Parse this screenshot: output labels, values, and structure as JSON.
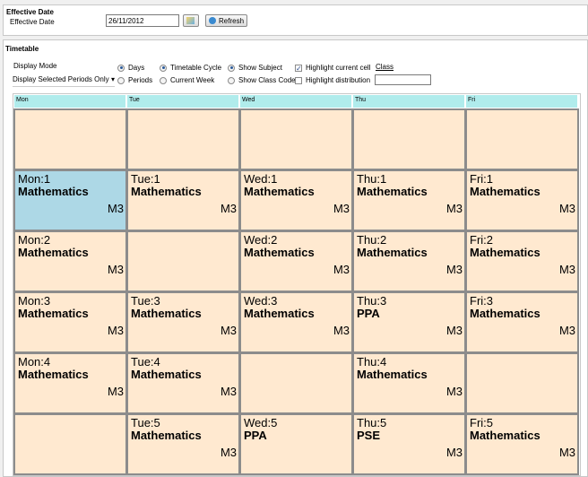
{
  "effective_date": {
    "section_title": "Effective Date",
    "label": "Effective Date",
    "value": "26/11/2012",
    "refresh_label": "Refresh"
  },
  "timetable": {
    "section_title": "Timetable",
    "display_mode_label": "Display Mode",
    "display_select": "Display Selected Periods Only",
    "radios": {
      "days": "Days",
      "periods": "Periods",
      "timetable_cycle": "Timetable Cycle",
      "current_week": "Current Week",
      "show_subject": "Show Subject",
      "show_class_code": "Show Class Code"
    },
    "selected": {
      "view": "Days",
      "cycle": "Timetable Cycle",
      "show": "Show Subject"
    },
    "checks": {
      "highlight_current": "Highlight current cell",
      "highlight_current_checked": true,
      "highlight_distribution": "Highlight distribution",
      "highlight_distribution_checked": false
    },
    "class_link": "Class",
    "class_value": "",
    "days": [
      "Mon",
      "Tue",
      "Wed",
      "Thu",
      "Fri"
    ],
    "rows": [
      [
        null,
        null,
        null,
        null,
        null
      ],
      [
        {
          "p": "Mon:1",
          "s": "Mathematics",
          "r": "M3",
          "hl": true
        },
        {
          "p": "Tue:1",
          "s": "Mathematics",
          "r": "M3"
        },
        {
          "p": "Wed:1",
          "s": "Mathematics",
          "r": "M3"
        },
        {
          "p": "Thu:1",
          "s": "Mathematics",
          "r": "M3"
        },
        {
          "p": "Fri:1",
          "s": "Mathematics",
          "r": "M3"
        }
      ],
      [
        {
          "p": "Mon:2",
          "s": "Mathematics",
          "r": "M3"
        },
        null,
        {
          "p": "Wed:2",
          "s": "Mathematics",
          "r": "M3"
        },
        {
          "p": "Thu:2",
          "s": "Mathematics",
          "r": "M3"
        },
        {
          "p": "Fri:2",
          "s": "Mathematics",
          "r": "M3"
        }
      ],
      [
        {
          "p": "Mon:3",
          "s": "Mathematics",
          "r": "M3"
        },
        {
          "p": "Tue:3",
          "s": "Mathematics",
          "r": "M3"
        },
        {
          "p": "Wed:3",
          "s": "Mathematics",
          "r": "M3"
        },
        {
          "p": "Thu:3",
          "s": "PPA",
          "r": "M3"
        },
        {
          "p": "Fri:3",
          "s": "Mathematics",
          "r": "M3"
        }
      ],
      [
        {
          "p": "Mon:4",
          "s": "Mathematics",
          "r": "M3"
        },
        {
          "p": "Tue:4",
          "s": "Mathematics",
          "r": "M3"
        },
        null,
        {
          "p": "Thu:4",
          "s": "Mathematics",
          "r": "M3"
        },
        null
      ],
      [
        null,
        {
          "p": "Tue:5",
          "s": "Mathematics",
          "r": "M3"
        },
        {
          "p": "Wed:5",
          "s": "PPA",
          "r": ""
        },
        {
          "p": "Thu:5",
          "s": "PSE",
          "r": "M3"
        },
        {
          "p": "Fri:5",
          "s": "Mathematics",
          "r": "M3"
        }
      ]
    ]
  },
  "colors": {
    "cell": "#ffe9d0",
    "highlight": "#add8e6",
    "header": "#b0ecec"
  }
}
